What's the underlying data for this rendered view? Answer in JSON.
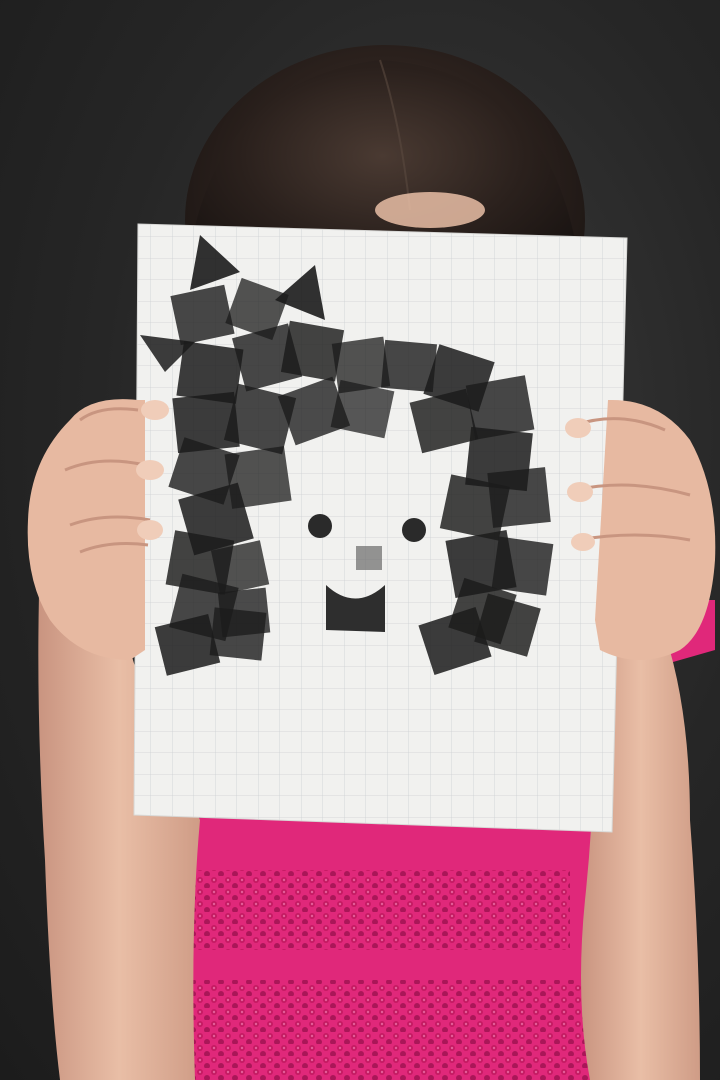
{
  "photo": {
    "subject": "child-holding-stamped-art",
    "colors": {
      "background": "#262626",
      "hair": "#2b211d",
      "skin": "#e9bea6",
      "shirt": "#e0287a",
      "sequin": "#c0185e",
      "paper": "#f1f1ef",
      "grid": "#c9ccd0",
      "ink": "#1b1b1b"
    }
  }
}
